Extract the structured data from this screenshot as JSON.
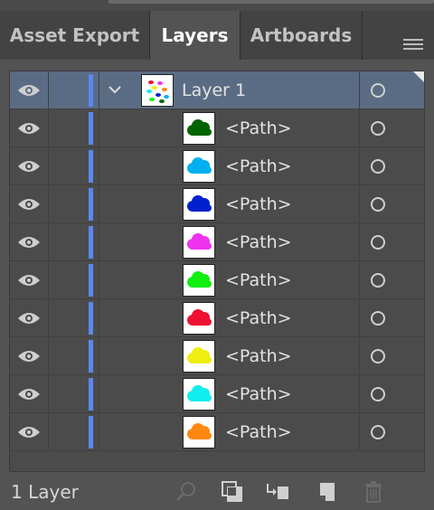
{
  "tabs": [
    {
      "label": "Asset Export",
      "active": false
    },
    {
      "label": "Layers",
      "active": true
    },
    {
      "label": "Artboards",
      "active": false
    }
  ],
  "panel_menu_icon": "hamburger-menu-icon",
  "layer": {
    "name": "Layer 1",
    "expanded": true,
    "selected": true,
    "visible": true,
    "layer_color": "#5b88f0"
  },
  "paths": [
    {
      "name": "<Path>",
      "color": "#006400",
      "visible": true
    },
    {
      "name": "<Path>",
      "color": "#00b0f0",
      "visible": true
    },
    {
      "name": "<Path>",
      "color": "#0022cc",
      "visible": true
    },
    {
      "name": "<Path>",
      "color": "#ee33ee",
      "visible": true
    },
    {
      "name": "<Path>",
      "color": "#11ee11",
      "visible": true
    },
    {
      "name": "<Path>",
      "color": "#ee1133",
      "visible": true
    },
    {
      "name": "<Path>",
      "color": "#eeee11",
      "visible": true
    },
    {
      "name": "<Path>",
      "color": "#11eeee",
      "visible": true
    },
    {
      "name": "<Path>",
      "color": "#ff8811",
      "visible": true
    }
  ],
  "footer": {
    "layer_count": "1 Layer",
    "icons": [
      "locate-object-icon",
      "make-clipping-mask-icon",
      "create-sublayer-icon",
      "create-new-layer-icon",
      "delete-icon"
    ]
  }
}
